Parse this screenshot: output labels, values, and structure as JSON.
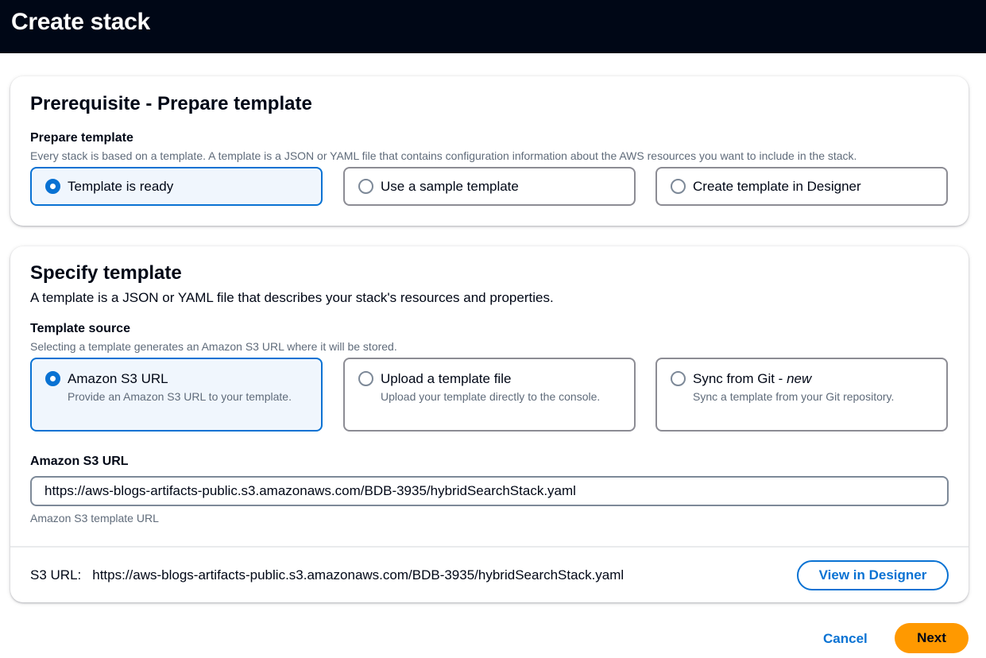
{
  "header": {
    "title": "Create stack"
  },
  "prerequisite": {
    "heading": "Prerequisite - Prepare template",
    "label": "Prepare template",
    "description": "Every stack is based on a template. A template is a JSON or YAML file that contains configuration information about the AWS resources you want to include in the stack.",
    "options": [
      {
        "label": "Template is ready",
        "selected": true
      },
      {
        "label": "Use a sample template",
        "selected": false
      },
      {
        "label": "Create template in Designer",
        "selected": false
      }
    ]
  },
  "specify": {
    "heading": "Specify template",
    "description": "A template is a JSON or YAML file that describes your stack's resources and properties.",
    "source_label": "Template source",
    "source_description": "Selecting a template generates an Amazon S3 URL where it will be stored.",
    "sources": [
      {
        "title": "Amazon S3 URL",
        "subtitle": "Provide an Amazon S3 URL to your template.",
        "selected": true
      },
      {
        "title": "Upload a template file",
        "subtitle": "Upload your template directly to the console.",
        "selected": false
      },
      {
        "title_main": "Sync from Git - ",
        "title_em": "new",
        "subtitle": "Sync a template from your Git repository.",
        "selected": false
      }
    ],
    "url_label": "Amazon S3 URL",
    "url_value": "https://aws-blogs-artifacts-public.s3.amazonaws.com/BDB-3935/hybridSearchStack.yaml",
    "url_hint": "Amazon S3 template URL",
    "s3_key": "S3 URL:",
    "s3_value": "https://aws-blogs-artifacts-public.s3.amazonaws.com/BDB-3935/hybridSearchStack.yaml",
    "view_designer": "View in Designer"
  },
  "footer": {
    "cancel": "Cancel",
    "next": "Next"
  },
  "colors": {
    "accent": "#0972d3",
    "primary_button": "#ff9900",
    "header_bg": "#000716"
  }
}
